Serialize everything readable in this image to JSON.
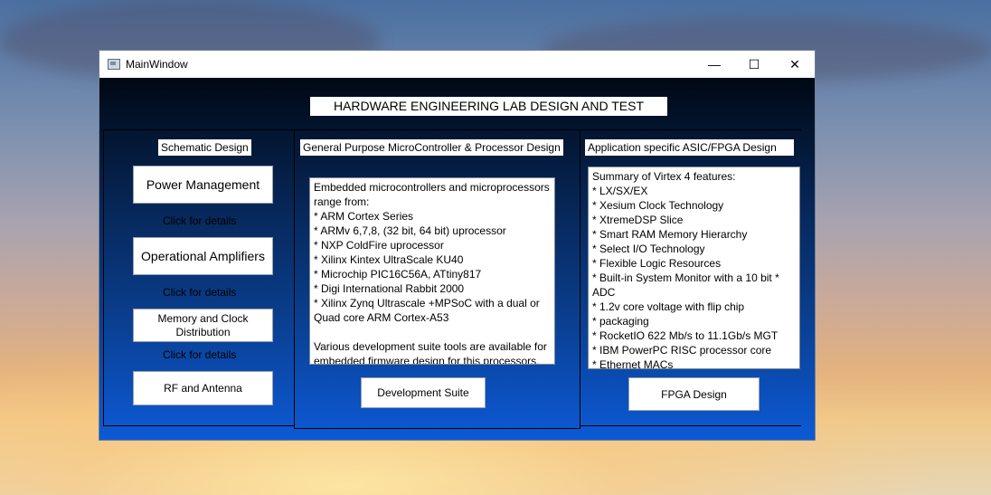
{
  "window": {
    "title": "MainWindow",
    "controls": {
      "minimize": "—",
      "maximize": "☐",
      "close": "✕"
    }
  },
  "header": {
    "title": "HARDWARE ENGINEERING LAB DESIGN AND TEST"
  },
  "schematic": {
    "title": "Schematic Design",
    "buttons": [
      "Power Management",
      "Operational Amplifiers",
      "Memory and Clock\nDistribution",
      "RF and Antenna"
    ],
    "hint": "Click for details"
  },
  "microcontroller": {
    "title": "General Purpose MicroController & Processor Design",
    "text_lines": [
      "Embedded microcontrollers and microprocessors",
      "range from:",
      "* ARM Cortex Series",
      "* ARMv 6,7,8, (32 bit, 64 bit) uprocessor",
      "* NXP ColdFire uprocessor",
      "* Xilinx Kintex UltraScale KU40",
      "* Microchip PIC16C56A, ATtiny817",
      "* Digi International Rabbit 2000",
      "* Xilinx Zynq Ultrascale +MPSoC with a dual or",
      "Quad core ARM Cortex-A53",
      "",
      "Various development suite tools are available for",
      "embedded firmware design for this processors."
    ],
    "button": "Development Suite"
  },
  "asic": {
    "title": "Application specific ASIC/FPGA Design",
    "text_lines": [
      "Summary of Virtex 4 features:",
      "* LX/SX/EX",
      "* Xesium Clock Technology",
      "* XtremeDSP Slice",
      "* Smart RAM Memory Hierarchy",
      "* Select I/O Technology",
      "* Flexible Logic Resources",
      "* Built-in System Monitor with a 10 bit *",
      "ADC",
      "* 1.2v core voltage with flip chip",
      "* packaging",
      "* RocketIO 622 Mb/s to 11.1Gb/s MGT",
      "* IBM PowerPC RISC processor core",
      "* Ethernet MACs"
    ],
    "button": "FPGA Design"
  }
}
